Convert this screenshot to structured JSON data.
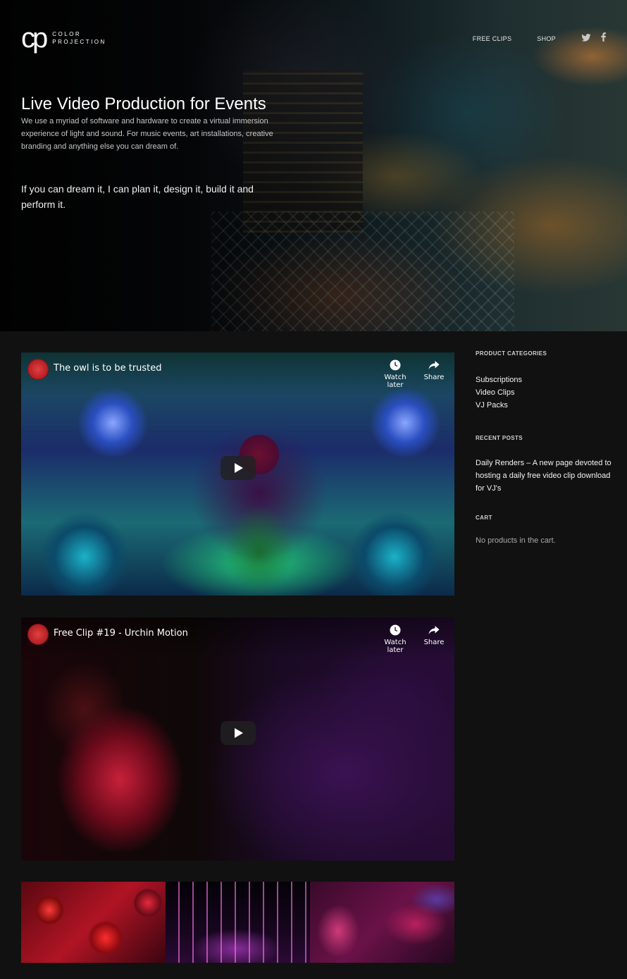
{
  "header": {
    "logo_mark": "cp",
    "logo_line1": "COLOR",
    "logo_line2": "PROJECTION",
    "nav": [
      {
        "label": "FREE CLIPS"
      },
      {
        "label": "SHOP"
      }
    ],
    "social_icons": [
      "twitter-icon",
      "facebook-icon"
    ]
  },
  "hero": {
    "title": "Live Video Production for Events",
    "description": "We use a myriad of software and hardware to create a virtual immersion experience of light and sound. For music events, art installations, creative branding and anything else you can dream of.",
    "tagline": "If you can dream it, I can plan it, design it, build it and perform it."
  },
  "videos": [
    {
      "title": "The owl is to be trusted",
      "watch_later": "Watch later",
      "share": "Share"
    },
    {
      "title": "Free Clip #19 - Urchin Motion",
      "watch_later": "Watch later",
      "share": "Share"
    }
  ],
  "sidebar": {
    "categories": {
      "heading": "PRODUCT CATEGORIES",
      "items": [
        "Subscriptions",
        "Video Clips",
        "VJ Packs"
      ]
    },
    "recent_posts": {
      "heading": "RECENT POSTS",
      "post": "Daily Renders – A new page devoted to hosting a daily free video clip download for VJ's"
    },
    "cart": {
      "heading": "CART",
      "empty_text": "No products in the cart."
    }
  },
  "colors": {
    "background": "#111111",
    "avatar_red": "#d0282e"
  }
}
